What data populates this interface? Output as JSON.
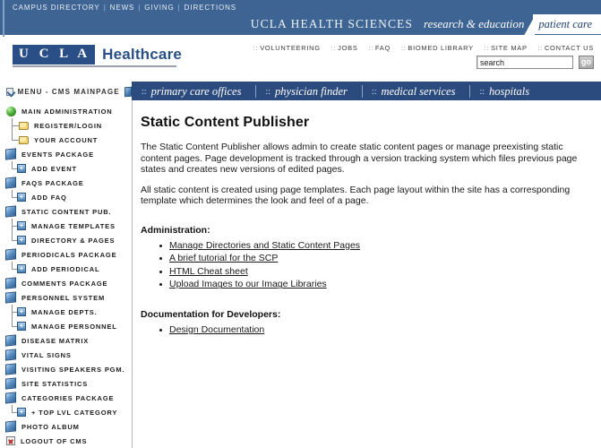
{
  "topbar": {
    "links": [
      "CAMPUS DIRECTORY",
      "NEWS",
      "GIVING",
      "DIRECTIONS"
    ],
    "separator": "|",
    "health_sciences": "UCLA HEALTH SCIENCES",
    "research_education": "research & education",
    "patient_care": "patient care",
    "bg_color": "#3d6493"
  },
  "brand": {
    "ucla": "U C L A",
    "healthcare": "Healthcare",
    "box_color": "#2a4f86"
  },
  "utility": {
    "links": [
      "VOLUNTEERING",
      "JOBS",
      "FAQ",
      "BIOMED LIBRARY",
      "SITE MAP",
      "CONTACT US"
    ],
    "dots": "::"
  },
  "search": {
    "value": "search",
    "placeholder": "search",
    "go_label": "go"
  },
  "nav": {
    "menu_icon": "window-icon",
    "menu_label": "MENU - CMS MAINPAGE",
    "doc_icon": "document-icon",
    "items": [
      {
        "prefix": "::",
        "label": "primary care offices"
      },
      {
        "prefix": "::",
        "label": "physician finder"
      },
      {
        "prefix": "::",
        "label": "medical services"
      },
      {
        "prefix": "::",
        "label": "hospitals"
      }
    ],
    "bg_color": "#2b4a7d"
  },
  "sidebar": {
    "items": [
      {
        "label": "MAIN ADMINISTRATION",
        "icon": "green-sphere-icon",
        "level": 0
      },
      {
        "label": "REGISTER/LOGIN",
        "icon": "folder-icon",
        "level": 1
      },
      {
        "label": "YOUR ACCOUNT",
        "icon": "folder-icon",
        "level": 1
      },
      {
        "label": "EVENTS PACKAGE",
        "icon": "package-icon",
        "level": 0
      },
      {
        "label": "ADD EVENT",
        "icon": "plus-icon",
        "level": 1
      },
      {
        "label": "FAQS PACKAGE",
        "icon": "package-icon",
        "level": 0
      },
      {
        "label": "ADD FAQ",
        "icon": "plus-icon",
        "level": 1
      },
      {
        "label": "STATIC CONTENT PUB.",
        "icon": "package-icon",
        "level": 0
      },
      {
        "label": "MANAGE TEMPLATES",
        "icon": "plus-icon",
        "level": 1
      },
      {
        "label": "DIRECTORY & PAGES",
        "icon": "plus-icon",
        "level": 1
      },
      {
        "label": "PERIODICALS PACKAGE",
        "icon": "package-icon",
        "level": 0
      },
      {
        "label": "ADD PERIODICAL",
        "icon": "plus-icon",
        "level": 1
      },
      {
        "label": "COMMENTS PACKAGE",
        "icon": "package-icon",
        "level": 0
      },
      {
        "label": "PERSONNEL SYSTEM",
        "icon": "package-icon",
        "level": 0
      },
      {
        "label": "MANAGE DEPTS.",
        "icon": "plus-icon",
        "level": 1
      },
      {
        "label": "MANAGE PERSONNEL",
        "icon": "plus-icon",
        "level": 1
      },
      {
        "label": "DISEASE MATRIX",
        "icon": "package-icon",
        "level": 0
      },
      {
        "label": "VITAL SIGNS",
        "icon": "package-icon",
        "level": 0
      },
      {
        "label": "VISITING SPEAKERS PGM.",
        "icon": "package-icon",
        "level": 0
      },
      {
        "label": "SITE STATISTICS",
        "icon": "package-icon",
        "level": 0
      },
      {
        "label": "CATEGORIES PACKAGE",
        "icon": "package-icon",
        "level": 0
      },
      {
        "label": "+ TOP LVL CATEGORY",
        "icon": "plus-icon",
        "level": 1
      },
      {
        "label": "PHOTO ALBUM",
        "icon": "package-icon",
        "level": 0
      },
      {
        "label": "LOGOUT OF CMS",
        "icon": "logout-icon",
        "level": 0
      }
    ]
  },
  "main": {
    "title": "Static Content Publisher",
    "paragraphs": [
      "The Static Content Publisher allows admin to create static content pages or manage preexisting static content pages. Page development is tracked through a version tracking system which files previous page states and creates new versions of edited pages.",
      "All static content is created using page templates. Each page layout within the site has a corresponding template which determines the look and feel of a page."
    ],
    "admin_heading": "Administration:",
    "admin_links": [
      "Manage Directories and Static Content Pages",
      "A brief tutorial for the SCP",
      "HTML Cheat sheet",
      "Upload Images to our Image Libraries"
    ],
    "docs_heading": "Documentation for Developers:",
    "docs_links": [
      "Design Documentation"
    ]
  }
}
